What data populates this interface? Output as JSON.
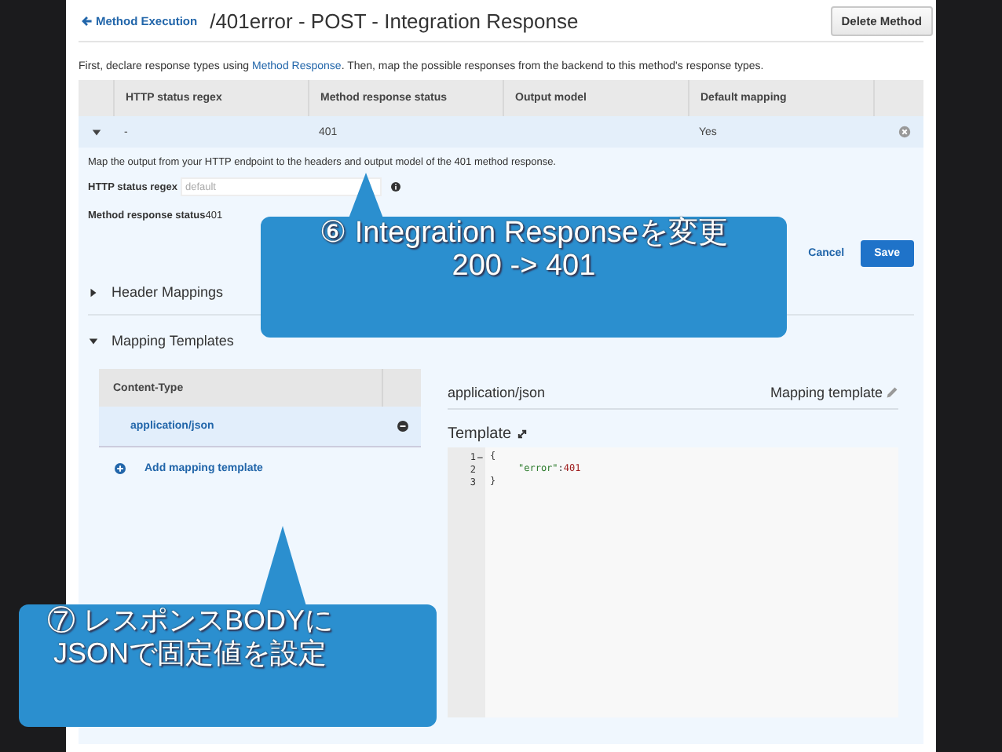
{
  "header": {
    "back_link": "Method Execution",
    "title": "/401error - POST - Integration Response",
    "delete_button": "Delete Method"
  },
  "intro": {
    "before": "First, declare response types using ",
    "link": "Method Response",
    "after": ". Then, map the possible responses from the backend to this method's response types."
  },
  "table": {
    "columns": [
      "HTTP status regex",
      "Method response status",
      "Output model",
      "Default mapping"
    ],
    "rows": [
      {
        "expanded": true,
        "cells": [
          "-",
          "401",
          "",
          "Yes"
        ]
      }
    ]
  },
  "detail": {
    "description": "Map the output from your HTTP endpoint to the headers and output model of the 401 method response.",
    "regex_label": "HTTP status regex",
    "regex_placeholder": "default",
    "status_label": "Method response status",
    "status_value": "401",
    "cancel": "Cancel",
    "save": "Save"
  },
  "sections": [
    {
      "title": "Header Mappings",
      "expanded": false
    },
    {
      "title": "Mapping Templates",
      "expanded": true
    }
  ],
  "content_types": {
    "heading": "Content-Type",
    "items": [
      {
        "label": "application/json",
        "selected": true
      }
    ],
    "add": "Add mapping template"
  },
  "template": {
    "content_type": "application/json",
    "mapping_label": "Mapping template",
    "heading": "Template",
    "lines": [
      {
        "number": "1",
        "fold": true,
        "tokens": [
          {
            "kind": "punct",
            "text": "{"
          }
        ]
      },
      {
        "number": "2",
        "fold": false,
        "tokens": [
          {
            "kind": "string",
            "text": "\"error\""
          },
          {
            "kind": "punct",
            "text": ":"
          },
          {
            "kind": "number",
            "text": "401"
          }
        ]
      },
      {
        "number": "3",
        "fold": false,
        "tokens": [
          {
            "kind": "punct",
            "text": "}"
          }
        ]
      }
    ]
  },
  "callouts": [
    {
      "lines": [
        "⑥ Integration Responseを変更",
        "200 -> 401"
      ]
    },
    {
      "lines": [
        "⑦ レスポンスBODYに",
        "JSONで固定値を設定"
      ]
    }
  ]
}
